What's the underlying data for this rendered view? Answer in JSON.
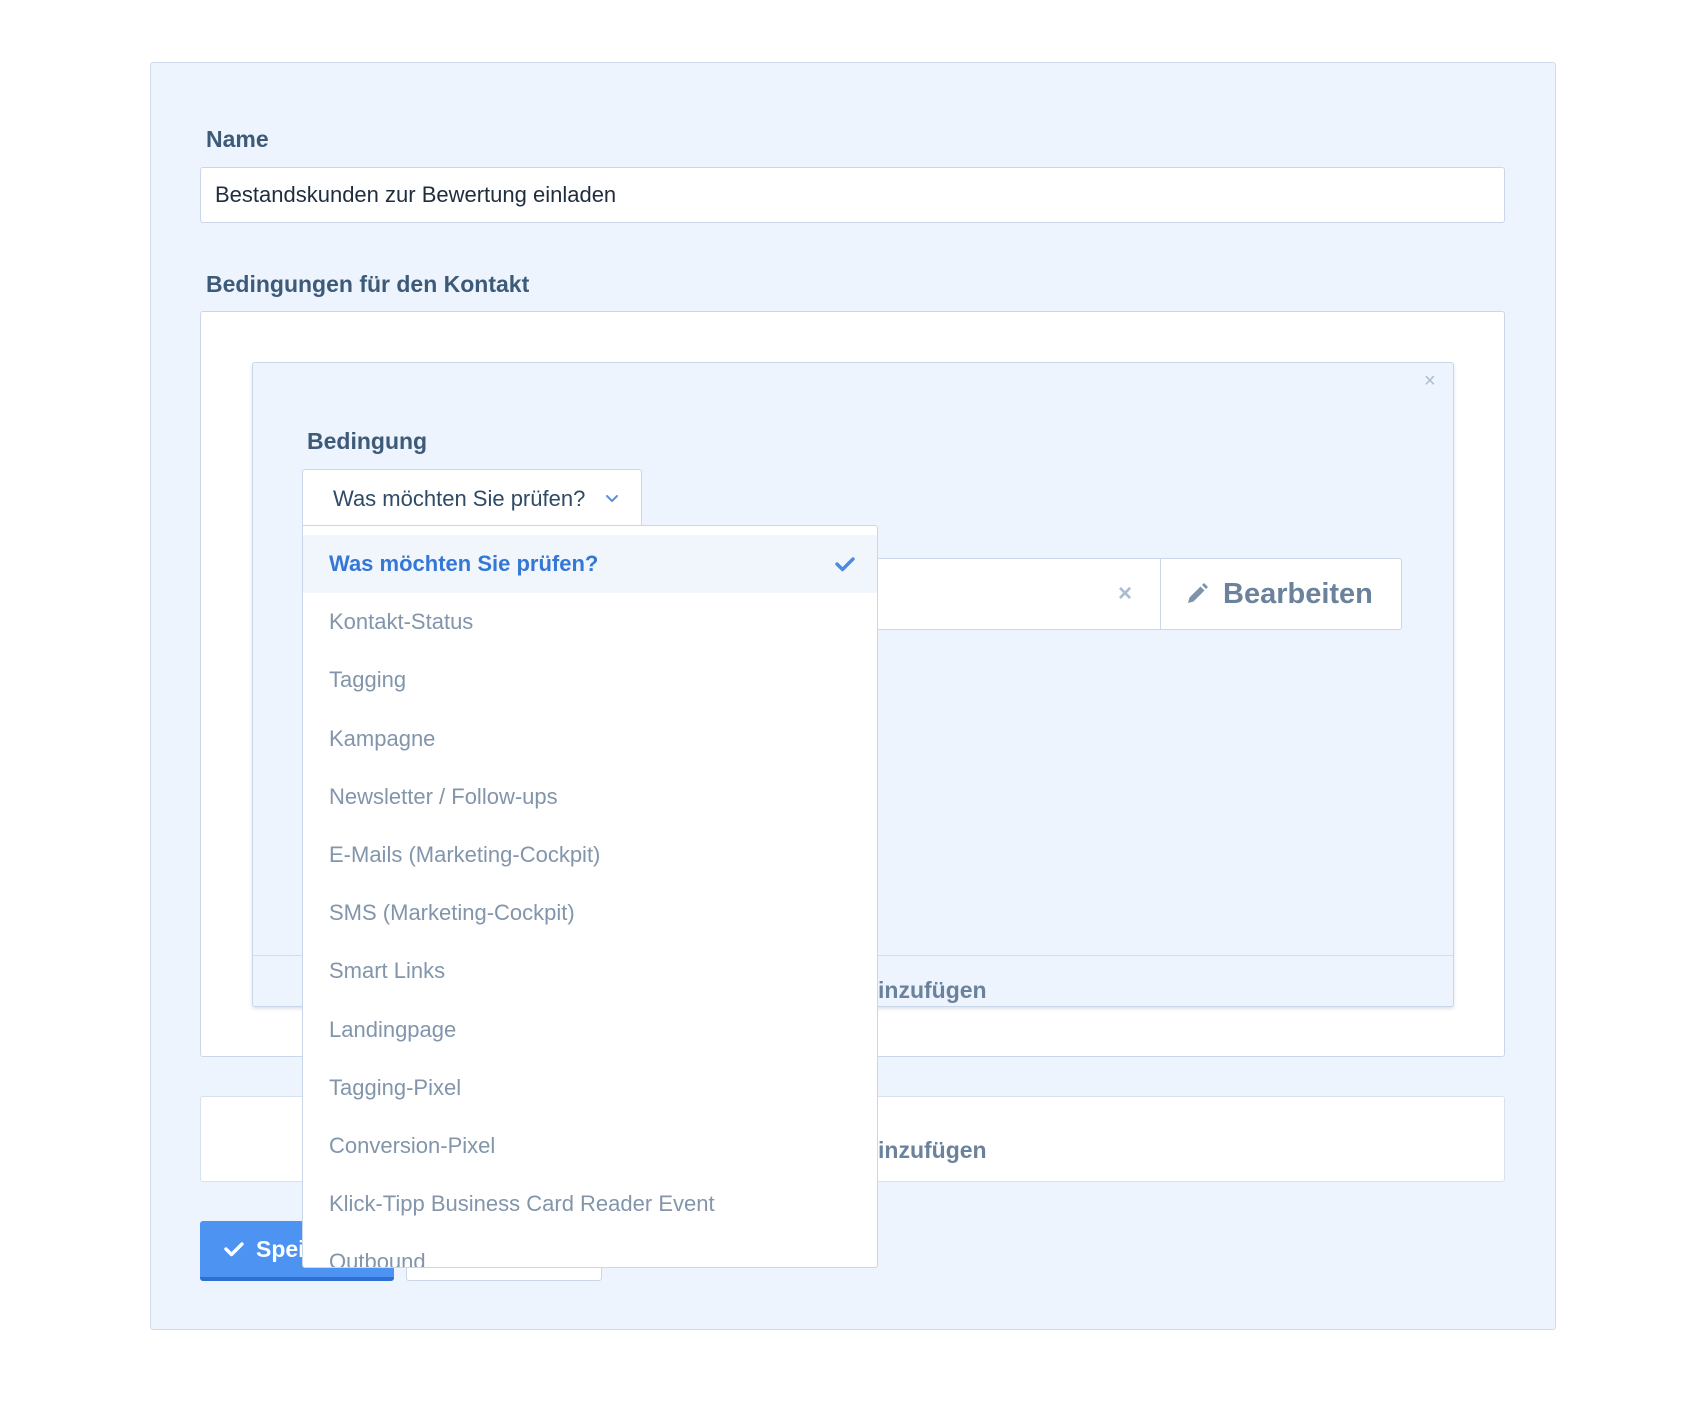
{
  "form": {
    "name_label": "Name",
    "name_value": "Bestandskunden zur Bewertung einladen",
    "conditions_label": "Bedingungen für den Kontakt"
  },
  "condition": {
    "close_symbol": "×",
    "label": "Bedingung",
    "select_value": "Was möchten Sie prüfen?",
    "value_clear_symbol": "×",
    "edit_label": "Bearbeiten",
    "add_condition_partial": "inzufügen"
  },
  "add_group_partial": "inzufügen",
  "buttons": {
    "save_partial": "Spei"
  },
  "dropdown": {
    "options": [
      "Was möchten Sie prüfen?",
      "Kontakt-Status",
      "Tagging",
      "Kampagne",
      "Newsletter / Follow-ups",
      "E-Mails (Marketing-Cockpit)",
      "SMS (Marketing-Cockpit)",
      "Smart Links",
      "Landingpage",
      "Tagging-Pixel",
      "Conversion-Pixel",
      "Klick-Tipp Business Card Reader Event",
      "Outbound"
    ],
    "selected_index": 0
  },
  "icons": {
    "select_chevron": "chevron-down-icon",
    "selected_check": "check-icon",
    "edit": "pencil-icon",
    "save": "check-icon"
  },
  "colors": {
    "panel_bg": "#edf4fe",
    "accent": "#4c93f2",
    "selected_text": "#3577d4",
    "label_text": "#3d5a78",
    "muted_text": "#8295ab"
  }
}
